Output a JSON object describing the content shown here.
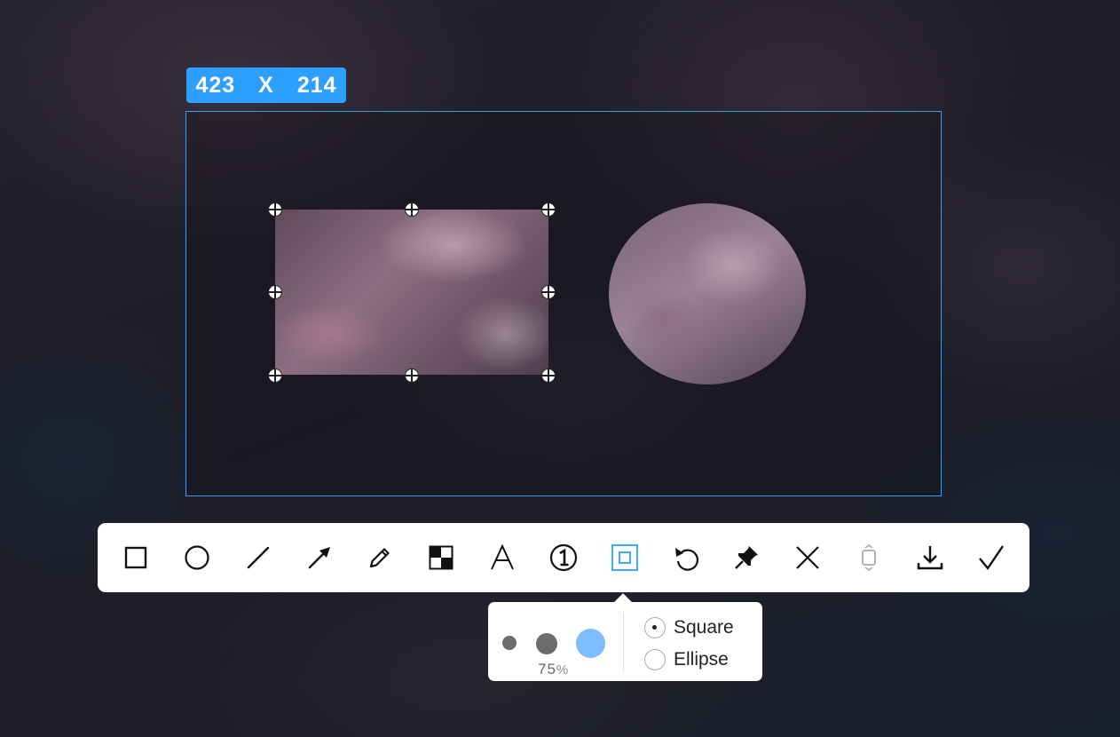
{
  "selection": {
    "width": "423",
    "separator": "X",
    "height": "214"
  },
  "toolbar": {
    "tools": [
      {
        "name": "rectangle-tool",
        "icon": "rectangle-icon"
      },
      {
        "name": "ellipse-tool",
        "icon": "circle-icon"
      },
      {
        "name": "line-tool",
        "icon": "line-icon"
      },
      {
        "name": "arrow-tool",
        "icon": "arrow-icon"
      },
      {
        "name": "pen-tool",
        "icon": "pencil-icon"
      },
      {
        "name": "mosaic-tool",
        "icon": "checker-icon"
      },
      {
        "name": "text-tool",
        "icon": "text-A-icon"
      },
      {
        "name": "number-tool",
        "icon": "circled-one-icon"
      },
      {
        "name": "mosaic-area-tool",
        "icon": "nested-square-icon",
        "active": true
      },
      {
        "name": "undo-tool",
        "icon": "undo-icon"
      },
      {
        "name": "pin-tool",
        "icon": "pin-icon"
      },
      {
        "name": "cancel-tool",
        "icon": "x-icon"
      },
      {
        "name": "long-screenshot-tool",
        "icon": "scroll-capture-icon",
        "disabled": true
      },
      {
        "name": "download-tool",
        "icon": "download-icon"
      },
      {
        "name": "confirm-tool",
        "icon": "checkmark-icon"
      }
    ],
    "accent_color": "#2c9fff"
  },
  "options": {
    "sizes": [
      "small",
      "medium",
      "large"
    ],
    "selected_size": "large",
    "selected_color": "#7cbcff",
    "opacity_value": "75",
    "opacity_unit": "%",
    "shape_square": "Square",
    "shape_ellipse": "Ellipse",
    "selected_shape": "Square"
  }
}
